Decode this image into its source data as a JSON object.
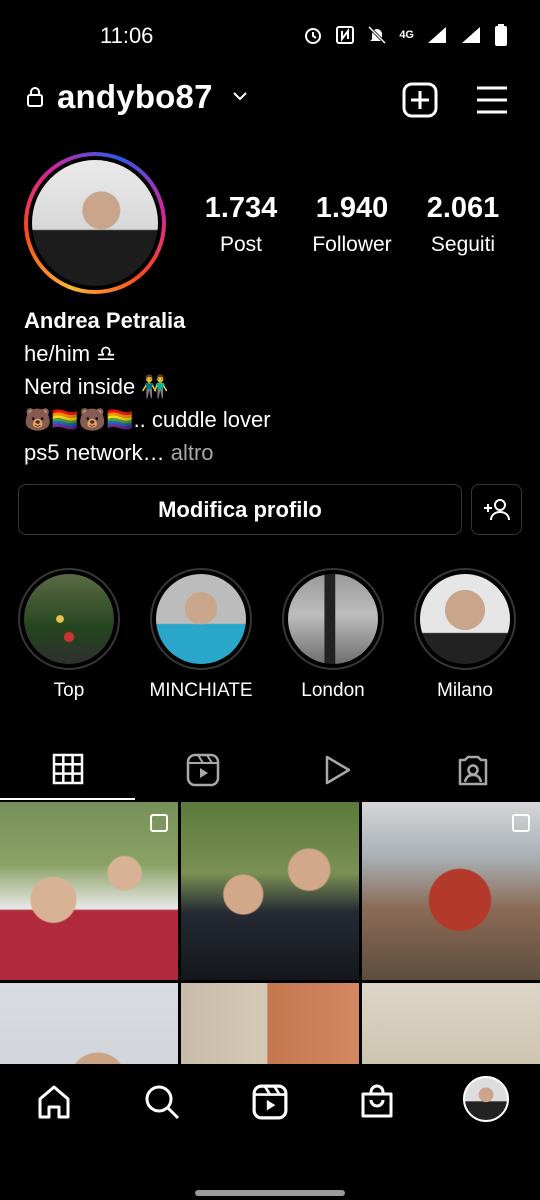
{
  "status_bar": {
    "time": "11:06",
    "network": "4G",
    "icons": [
      "alarm-icon",
      "nfc-icon",
      "mute-icon",
      "signal-icon",
      "battery-icon"
    ]
  },
  "header": {
    "username": "andybo87",
    "icons": [
      "lock-icon",
      "chevron-down-icon",
      "new-post-icon",
      "menu-icon"
    ]
  },
  "profile": {
    "stats": [
      {
        "value": "1.734",
        "label": "Post"
      },
      {
        "value": "1.940",
        "label": "Follower"
      },
      {
        "value": "2.061",
        "label": "Seguiti"
      }
    ],
    "bio": {
      "name": "Andrea Petralia",
      "line1": "he/him ♎",
      "line2": " Nerd inside 👬",
      "line3": "🐻🏳️‍🌈🐻🏳️‍🌈.. cuddle lover",
      "line4": "ps5 network…",
      "more": " altro"
    }
  },
  "actions": {
    "edit_label": "Modifica profilo"
  },
  "highlights": [
    {
      "label": "Top"
    },
    {
      "label": "MINCHIATE"
    },
    {
      "label": "London"
    },
    {
      "label": "Milano"
    }
  ],
  "tabs": [
    "grid-icon",
    "reels-icon",
    "video-icon",
    "tagged-icon"
  ],
  "nav": [
    "home-icon",
    "search-icon",
    "reels-icon",
    "shop-icon",
    "profile-avatar"
  ],
  "colors": {
    "background": "#000000",
    "border": "#363636",
    "muted_text": "#a8a8a8"
  }
}
